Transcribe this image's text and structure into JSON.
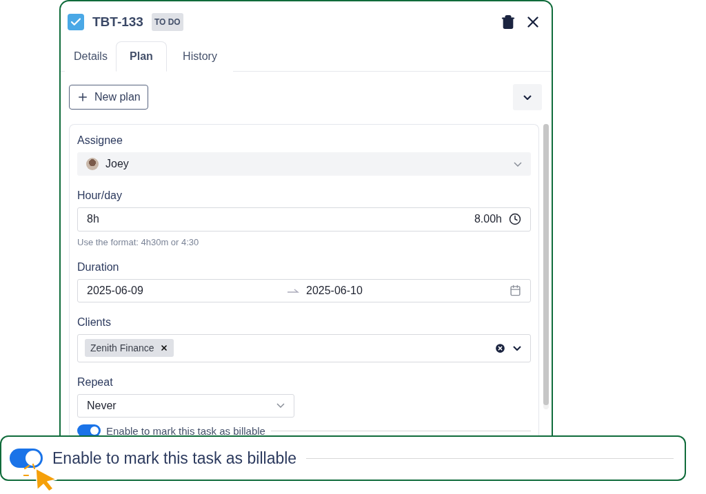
{
  "task": {
    "checked": true,
    "key": "TBT-133",
    "status": "TO DO"
  },
  "tabs": [
    {
      "label": "Details",
      "selected": false
    },
    {
      "label": "Plan",
      "selected": true
    },
    {
      "label": "History",
      "selected": false
    }
  ],
  "new_plan_button": "New plan",
  "form": {
    "assignee": {
      "label": "Assignee",
      "value": "Joey"
    },
    "hours": {
      "label": "Hour/day",
      "value": "8h",
      "computed": "8.00h",
      "hint": "Use the format: 4h30m or 4:30"
    },
    "duration": {
      "label": "Duration",
      "start": "2025-06-09",
      "end": "2025-06-10"
    },
    "clients": {
      "label": "Clients",
      "tags": [
        "Zenith Finance"
      ]
    },
    "repeat": {
      "label": "Repeat",
      "value": "Never"
    },
    "billable": {
      "on": true,
      "label": "Enable to mark this task as billable"
    }
  },
  "callout": {
    "on": true,
    "label": "Enable to mark this task as billable"
  }
}
